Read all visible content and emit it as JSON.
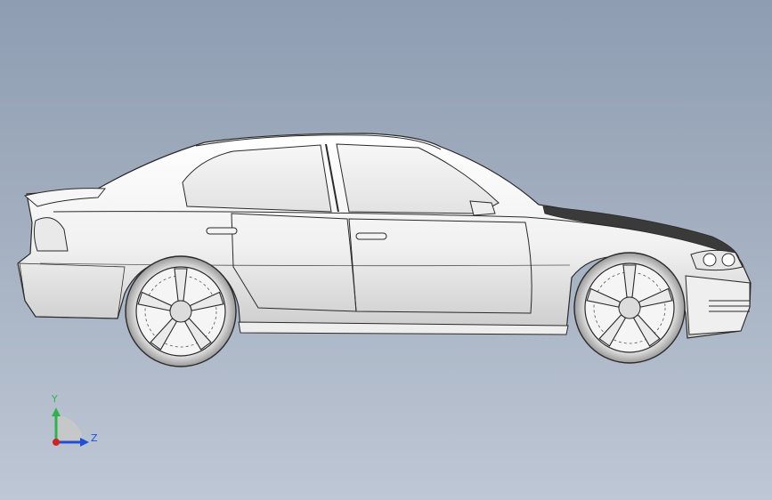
{
  "viewport": {
    "background_top": "#8e9db2",
    "background_bottom": "#bec7d5",
    "model": {
      "subject": "sedan-side-view",
      "body_color": "#f2f2f2",
      "edge_color": "#2a2a2a"
    }
  },
  "triad": {
    "y_label": "Y",
    "z_label": "Z",
    "y_color": "#2fb44a",
    "z_color": "#1f4fd8",
    "origin_color": "#d62020"
  }
}
